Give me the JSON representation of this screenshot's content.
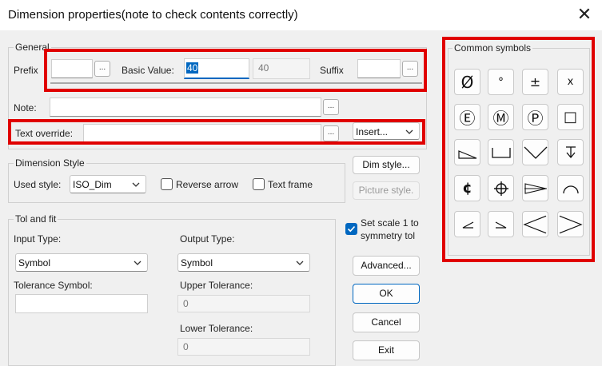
{
  "window": {
    "title": "Dimension properties(note to check contents correctly)"
  },
  "general": {
    "legend": "General",
    "prefix_label": "Prefix",
    "prefix_value": "",
    "basic_value_label": "Basic Value:",
    "basic_value": "40",
    "basic_value_readonly": "40",
    "suffix_label": "Suffix",
    "suffix_value": "",
    "note_label": "Note:",
    "note_value": "",
    "text_override_label": "Text override:",
    "text_override_value": "",
    "insert_label": "Insert...",
    "ellipsis": "..."
  },
  "dimension_style": {
    "legend": "Dimension Style",
    "used_style_label": "Used style:",
    "used_style_value": "ISO_Dim",
    "reverse_arrow_label": "Reverse arrow",
    "reverse_arrow_checked": false,
    "text_frame_label": "Text frame",
    "text_frame_checked": false
  },
  "tol_fit": {
    "legend": "Tol and fit",
    "input_type_label": "Input Type:",
    "input_type_value": "Symbol",
    "output_type_label": "Output Type:",
    "output_type_value": "Symbol",
    "tolerance_symbol_label": "Tolerance Symbol:",
    "tolerance_symbol_value": "",
    "upper_tolerance_label": "Upper Tolerance:",
    "upper_tolerance_value": "0",
    "lower_tolerance_label": "Lower Tolerance:",
    "lower_tolerance_value": "0"
  },
  "buttons": {
    "dim_style": "Dim style...",
    "picture_style": "Picture style.",
    "set_scale": "Set scale 1 to symmetry tol",
    "set_scale_line1": "Set scale 1 to",
    "set_scale_line2": "symmetry tol",
    "set_scale_checked": true,
    "advanced": "Advanced...",
    "ok": "OK",
    "cancel": "Cancel",
    "exit": "Exit"
  },
  "symbols": {
    "legend": "Common symbols",
    "items": [
      {
        "name": "diameter",
        "glyph": "Ø"
      },
      {
        "name": "degree",
        "glyph": "°"
      },
      {
        "name": "plus-minus",
        "glyph": "±"
      },
      {
        "name": "times",
        "glyph": "x"
      },
      {
        "name": "circled-e",
        "glyph": "Ⓔ"
      },
      {
        "name": "circled-m",
        "glyph": "Ⓜ"
      },
      {
        "name": "circled-p",
        "glyph": "Ⓟ"
      },
      {
        "name": "square",
        "glyph": "□"
      },
      {
        "name": "slope",
        "glyph": ""
      },
      {
        "name": "counterbore",
        "glyph": ""
      },
      {
        "name": "countersink",
        "glyph": ""
      },
      {
        "name": "depth",
        "glyph": ""
      },
      {
        "name": "centerline",
        "glyph": "¢"
      },
      {
        "name": "target",
        "glyph": ""
      },
      {
        "name": "conical-taper",
        "glyph": ""
      },
      {
        "name": "arc",
        "glyph": ""
      },
      {
        "name": "small-angle-left",
        "glyph": ""
      },
      {
        "name": "small-angle-right",
        "glyph": ""
      },
      {
        "name": "less-than",
        "glyph": ""
      },
      {
        "name": "greater-than",
        "glyph": ""
      }
    ]
  },
  "colors": {
    "highlight": "#e00000",
    "accent": "#0067c0"
  }
}
